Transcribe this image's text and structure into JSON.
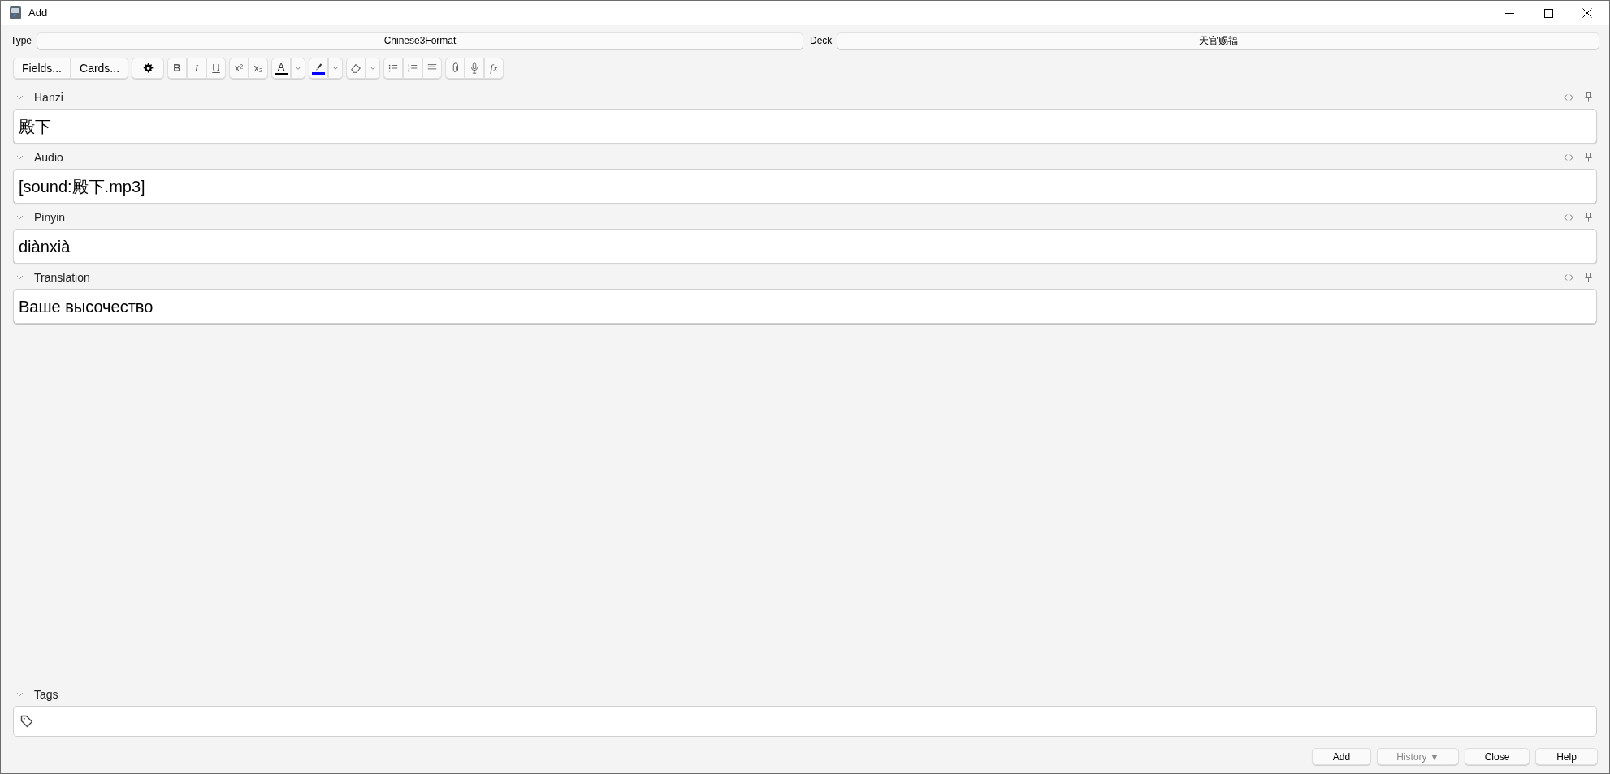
{
  "window": {
    "title": "Add"
  },
  "note_type": {
    "label": "Type",
    "value": "Chinese3Format"
  },
  "deck": {
    "label": "Deck",
    "value": "天官赐福"
  },
  "toolbar": {
    "buttons": [
      "Fields...",
      "Cards..."
    ],
    "format_labels": [
      "B",
      "I",
      "U",
      "x²",
      "x₂"
    ],
    "text_color": {
      "label": "A",
      "color": "#000000"
    },
    "highlight": {
      "color": "#0000ff"
    },
    "function_label": "fx"
  },
  "fields": [
    {
      "label": "Hanzi",
      "value": "殿下"
    },
    {
      "label": "Audio",
      "value": "[sound:殿下.mp3]"
    },
    {
      "label": "Pinyin",
      "value": "diànxià"
    },
    {
      "label": "Translation",
      "value": "Ваше высочество"
    }
  ],
  "tags": {
    "label": "Tags"
  },
  "buttons": [
    {
      "label": "Add",
      "disabled": false
    },
    {
      "label": "History ▼",
      "disabled": true
    },
    {
      "label": "Close",
      "disabled": false
    },
    {
      "label": "Help",
      "disabled": false
    }
  ]
}
